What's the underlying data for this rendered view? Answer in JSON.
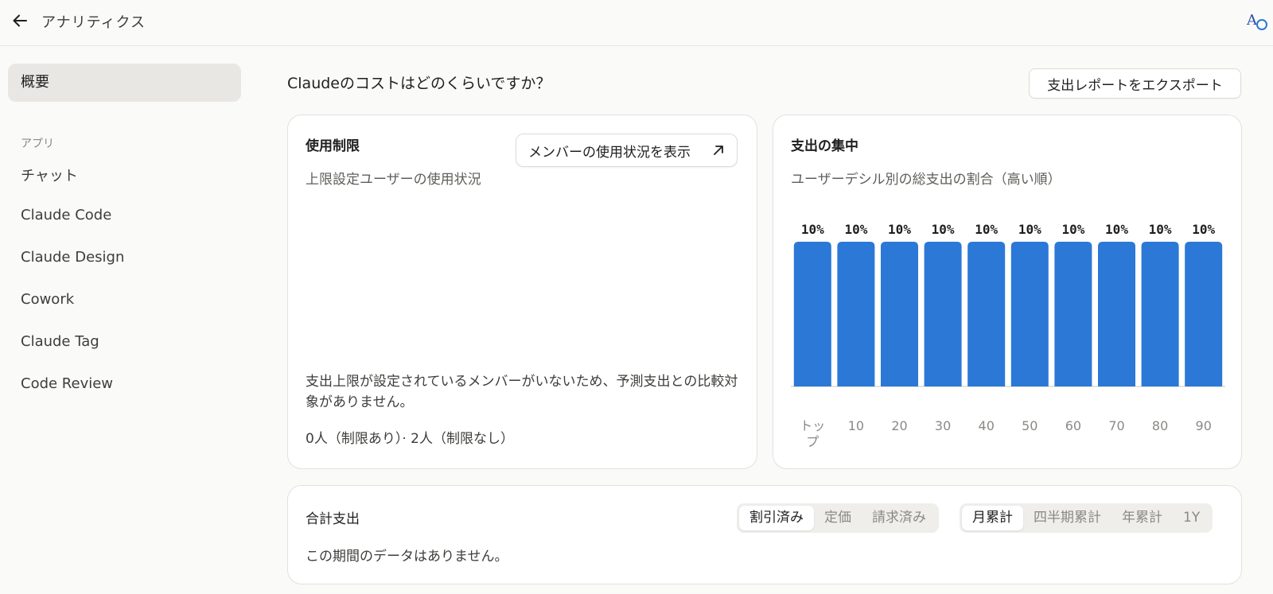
{
  "header": {
    "title": "アナリティクス",
    "back_icon": "arrow-left-icon",
    "avatar_icon": "app-logo-icon"
  },
  "sidebar": {
    "active_item": "概要",
    "section_label": "アプリ",
    "items": [
      "チャット",
      "Claude Code",
      "Claude Design",
      "Cowork",
      "Claude Tag",
      "Code Review"
    ]
  },
  "main": {
    "question": "Claudeのコストはどのくらいですか？",
    "export_label": "支出レポートをエクスポート"
  },
  "usage_card": {
    "title": "使用制限",
    "subtitle": "上限設定ユーザーの使用状況",
    "members_button": "メンバーの使用状況を表示",
    "note": "支出上限が設定されているメンバーがいないため、予測支出との比較対象がありません。",
    "count": "0人（制限あり）· 2人（制限なし）"
  },
  "spend_card": {
    "title": "支出の集中",
    "subtitle": "ユーザーデシル別の総支出の割合（高い順）"
  },
  "chart_data": {
    "type": "bar",
    "categories": [
      "トップ",
      "10",
      "20",
      "30",
      "40",
      "50",
      "60",
      "70",
      "80",
      "90"
    ],
    "values": [
      10,
      10,
      10,
      10,
      10,
      10,
      10,
      10,
      10,
      10
    ],
    "value_labels": [
      "10%",
      "10%",
      "10%",
      "10%",
      "10%",
      "10%",
      "10%",
      "10%",
      "10%",
      "10%"
    ],
    "bar_color": "#2b78d6",
    "title": "",
    "xlabel": "",
    "ylabel": "",
    "grid": false
  },
  "total_card": {
    "title": "合計支出",
    "empty": "この期間のデータはありません。",
    "price_tabs": [
      "割引済み",
      "定価",
      "請求済み"
    ],
    "period_tabs": [
      "月累計",
      "四半期累計",
      "年累計",
      "1Y"
    ],
    "active_price": "割引済み",
    "active_period": "月累計"
  }
}
